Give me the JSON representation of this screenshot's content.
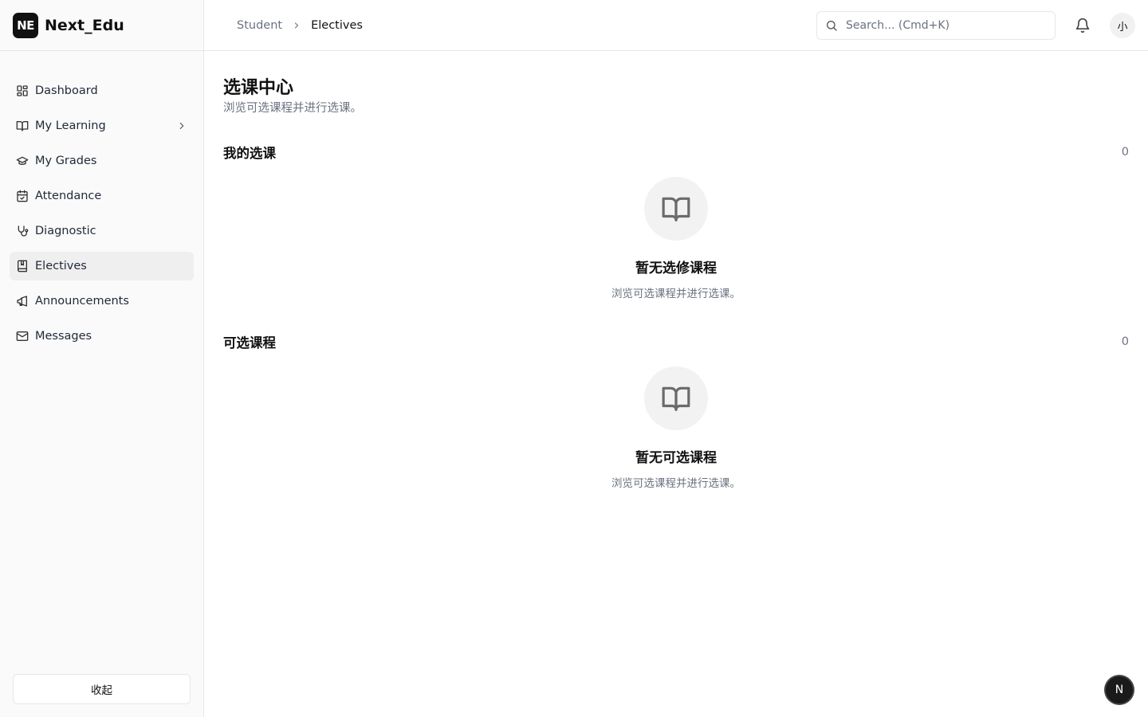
{
  "brand": {
    "logo_text": "NE",
    "name": "Next_Edu"
  },
  "sidebar": {
    "items": [
      {
        "label": "Dashboard",
        "icon": "dashboard-icon"
      },
      {
        "label": "My Learning",
        "icon": "book-open-icon",
        "has_submenu": true
      },
      {
        "label": "My Grades",
        "icon": "graduation-cap-icon"
      },
      {
        "label": "Attendance",
        "icon": "calendar-check-icon"
      },
      {
        "label": "Diagnostic",
        "icon": "stethoscope-icon"
      },
      {
        "label": "Electives",
        "icon": "bookmark-book-icon",
        "active": true
      },
      {
        "label": "Announcements",
        "icon": "megaphone-icon"
      },
      {
        "label": "Messages",
        "icon": "mail-icon"
      }
    ],
    "collapse_label": "收起"
  },
  "header": {
    "breadcrumb": {
      "root": "Student",
      "current": "Electives"
    },
    "search": {
      "placeholder": "Search... (Cmd+K)"
    },
    "avatar_text": "小"
  },
  "page": {
    "title": "选课中心",
    "subtitle": "浏览可选课程并进行选课。"
  },
  "sections": [
    {
      "title": "我的选课",
      "count": "0",
      "empty_title": "暂无选修课程",
      "empty_desc": "浏览可选课程并进行选课。"
    },
    {
      "title": "可选课程",
      "count": "0",
      "empty_title": "暂无可选课程",
      "empty_desc": "浏览可选课程并进行选课。"
    }
  ],
  "fab_text": "N",
  "colors": {
    "sidebar_bg": "#fafafa",
    "active_item_bg": "#efefef",
    "border": "#e5e7eb",
    "muted_text": "#6b7280",
    "logo_bg": "#111111"
  }
}
